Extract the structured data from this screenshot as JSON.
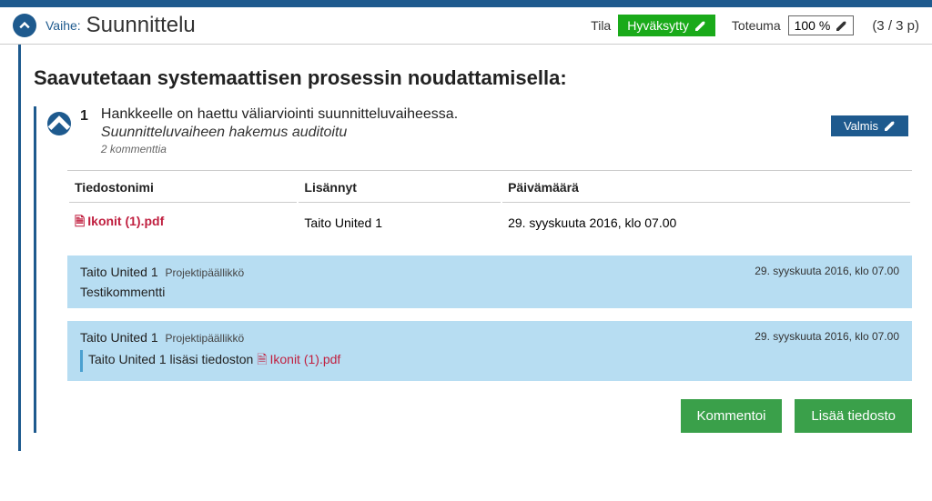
{
  "phase": {
    "label": "Vaihe:",
    "name": "Suunnittelu",
    "status_label": "Tila",
    "status_value": "Hyväksytty",
    "toteuma_label": "Toteuma",
    "toteuma_value": "100 %",
    "page_count": "(3 / 3 p)"
  },
  "section": {
    "title": "Saavutetaan systemaattisen prosessin noudattamisella:"
  },
  "task": {
    "number": "1",
    "title": "Hankkeelle on haettu väliarviointi suunnitteluvaiheessa.",
    "subtitle": "Suunnitteluvaiheen hakemus auditoitu",
    "comments_count": "2 kommenttia",
    "done_label": "Valmis"
  },
  "files": {
    "headers": {
      "name": "Tiedostonimi",
      "added_by": "Lisännyt",
      "date": "Päivämäärä"
    },
    "rows": [
      {
        "name": "Ikonit (1).pdf",
        "added_by": "Taito United 1",
        "date": "29. syyskuuta 2016, klo 07.00"
      }
    ]
  },
  "comments": [
    {
      "author": "Taito United 1",
      "role": "Projektipäällikkö",
      "date": "29. syyskuuta 2016, klo 07.00",
      "body": "Testikommentti",
      "has_file": false
    },
    {
      "author": "Taito United 1",
      "role": "Projektipäällikkö",
      "date": "29. syyskuuta 2016, klo 07.00",
      "body_prefix": "Taito United 1 lisäsi tiedoston ",
      "file_name": "Ikonit (1).pdf",
      "has_file": true
    }
  ],
  "actions": {
    "comment": "Kommentoi",
    "add_file": "Lisää tiedosto"
  }
}
